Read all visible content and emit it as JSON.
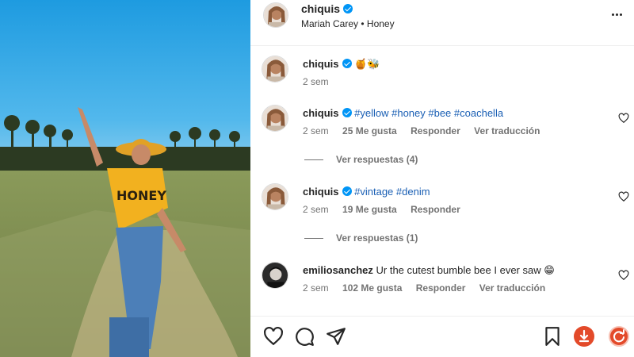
{
  "post": {
    "username": "chiquis",
    "song_artist": "Mariah Carey",
    "song_separator": "•",
    "song_title": "Honey"
  },
  "caption": {
    "username": "chiquis",
    "emojis": "🍯🐝",
    "time": "2 sem"
  },
  "comments": [
    {
      "username": "chiquis",
      "text": "#yellow #honey #bee #coachella",
      "time": "2 sem",
      "likes": "25 Me gusta",
      "reply_label": "Responder",
      "translate_label": "Ver traducción",
      "view_replies": "Ver respuestas (4)"
    },
    {
      "username": "chiquis",
      "text": "#vintage #denim",
      "time": "2 sem",
      "likes": "19 Me gusta",
      "reply_label": "Responder",
      "view_replies": "Ver respuestas (1)"
    },
    {
      "username": "emiliosanchez",
      "text": "Ur the cutest bumble bee I ever saw 😁",
      "time": "2 sem",
      "likes": "102 Me gusta",
      "reply_label": "Responder",
      "translate_label": "Ver traducción"
    }
  ],
  "icons": {
    "verified": "verified-badge-icon",
    "more": "more-options-icon",
    "like": "heart-icon",
    "comment": "comment-icon",
    "share": "send-icon",
    "save": "bookmark-icon",
    "download": "download-icon",
    "refresh": "refresh-icon"
  },
  "colors": {
    "verified": "#0095f6",
    "hashtag": "#1a5fb4",
    "muted": "#737373",
    "extension": "#e34a2a"
  }
}
